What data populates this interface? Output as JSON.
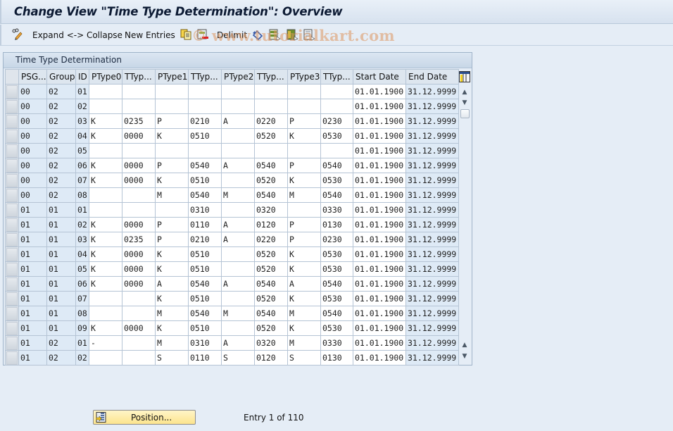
{
  "window": {
    "title": "Change View \"Time Type Determination\": Overview"
  },
  "toolbar": {
    "edit_icon": "pencil-glasses-icon",
    "expand_collapse_label": "Expand <-> Collapse",
    "new_entries_label": "New Entries",
    "copy_icon": "copy-icon",
    "delete_icon": "delete-icon",
    "delimit_label": "Delimit",
    "undo_icon": "undo-change-icon",
    "select_all_icon": "select-all-icon",
    "select_block_icon": "select-block-icon",
    "deselect_all_icon": "deselect-all-icon"
  },
  "watermark": "© www.tutorialkart.com",
  "table": {
    "title": "Time Type Determination",
    "columns": [
      "PSG...",
      "Group",
      "ID",
      "PType0",
      "TTyp...",
      "PType1",
      "TTyp...",
      "PType2",
      "TTyp...",
      "PType3",
      "TTyp...",
      "Start Date",
      "End Date"
    ],
    "rows": [
      [
        "00",
        "02",
        "01",
        "",
        "",
        "",
        "",
        "",
        "",
        "",
        "",
        "01.01.1900",
        "31.12.9999"
      ],
      [
        "00",
        "02",
        "02",
        "",
        "",
        "",
        "",
        "",
        "",
        "",
        "",
        "01.01.1900",
        "31.12.9999"
      ],
      [
        "00",
        "02",
        "03",
        "K",
        "0235",
        "P",
        "0210",
        "A",
        "0220",
        "P",
        "0230",
        "01.01.1900",
        "31.12.9999"
      ],
      [
        "00",
        "02",
        "04",
        "K",
        "0000",
        "K",
        "0510",
        "",
        "0520",
        "K",
        "0530",
        "01.01.1900",
        "31.12.9999"
      ],
      [
        "00",
        "02",
        "05",
        "",
        "",
        "",
        "",
        "",
        "",
        "",
        "",
        "01.01.1900",
        "31.12.9999"
      ],
      [
        "00",
        "02",
        "06",
        "K",
        "0000",
        "P",
        "0540",
        "A",
        "0540",
        "P",
        "0540",
        "01.01.1900",
        "31.12.9999"
      ],
      [
        "00",
        "02",
        "07",
        "K",
        "0000",
        "K",
        "0510",
        "",
        "0520",
        "K",
        "0530",
        "01.01.1900",
        "31.12.9999"
      ],
      [
        "00",
        "02",
        "08",
        "",
        "",
        "M",
        "0540",
        "M",
        "0540",
        "M",
        "0540",
        "01.01.1900",
        "31.12.9999"
      ],
      [
        "01",
        "01",
        "01",
        "",
        "",
        "",
        "0310",
        "",
        "0320",
        "",
        "0330",
        "01.01.1900",
        "31.12.9999"
      ],
      [
        "01",
        "01",
        "02",
        "K",
        "0000",
        "P",
        "0110",
        "A",
        "0120",
        "P",
        "0130",
        "01.01.1900",
        "31.12.9999"
      ],
      [
        "01",
        "01",
        "03",
        "K",
        "0235",
        "P",
        "0210",
        "A",
        "0220",
        "P",
        "0230",
        "01.01.1900",
        "31.12.9999"
      ],
      [
        "01",
        "01",
        "04",
        "K",
        "0000",
        "K",
        "0510",
        "",
        "0520",
        "K",
        "0530",
        "01.01.1900",
        "31.12.9999"
      ],
      [
        "01",
        "01",
        "05",
        "K",
        "0000",
        "K",
        "0510",
        "",
        "0520",
        "K",
        "0530",
        "01.01.1900",
        "31.12.9999"
      ],
      [
        "01",
        "01",
        "06",
        "K",
        "0000",
        "A",
        "0540",
        "A",
        "0540",
        "A",
        "0540",
        "01.01.1900",
        "31.12.9999"
      ],
      [
        "01",
        "01",
        "07",
        "",
        "",
        "K",
        "0510",
        "",
        "0520",
        "K",
        "0530",
        "01.01.1900",
        "31.12.9999"
      ],
      [
        "01",
        "01",
        "08",
        "",
        "",
        "M",
        "0540",
        "M",
        "0540",
        "M",
        "0540",
        "01.01.1900",
        "31.12.9999"
      ],
      [
        "01",
        "01",
        "09",
        "K",
        "0000",
        "K",
        "0510",
        "",
        "0520",
        "K",
        "0530",
        "01.01.1900",
        "31.12.9999"
      ],
      [
        "01",
        "02",
        "01",
        "-",
        "",
        "M",
        "0310",
        "A",
        "0320",
        "M",
        "0330",
        "01.01.1900",
        "31.12.9999"
      ],
      [
        "01",
        "02",
        "02",
        "",
        "",
        "S",
        "0110",
        "S",
        "0120",
        "S",
        "0130",
        "01.01.1900",
        "31.12.9999"
      ]
    ]
  },
  "footer": {
    "position_label": "Position...",
    "entry_info": "Entry 1 of 110"
  },
  "colors": {
    "background": "#e5edf6",
    "key_column": "#deeaf6",
    "position_button": "#fce48d",
    "watermark": "#de965f"
  }
}
